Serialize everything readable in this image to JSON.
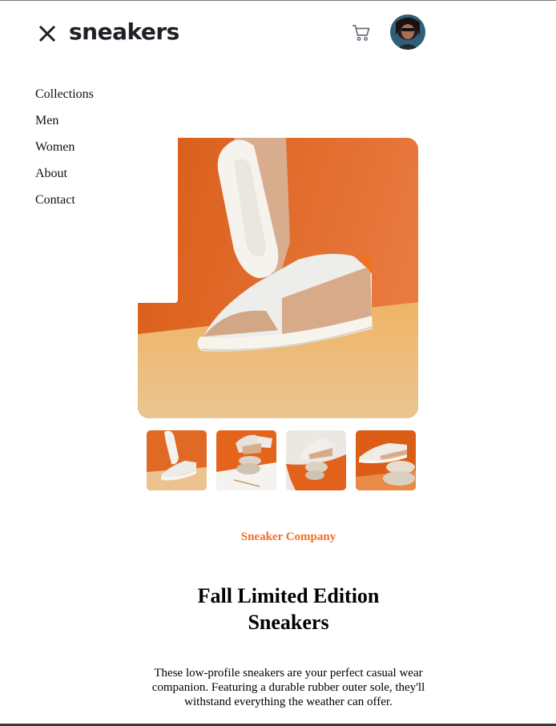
{
  "header": {
    "close_icon": "close-icon",
    "brand": "sneakers",
    "cart_icon": "cart-icon",
    "avatar_icon": "user-avatar"
  },
  "nav": {
    "items": [
      {
        "label": "Collections"
      },
      {
        "label": "Men"
      },
      {
        "label": "Women"
      },
      {
        "label": "About"
      },
      {
        "label": "Contact"
      }
    ]
  },
  "product": {
    "company": "Sneaker Company",
    "title_line1": "Fall Limited Edition",
    "title_line2": "Sneakers",
    "description": "These low-profile sneakers are your perfect casual wear companion. Featuring a durable rubber outer sole, they'll withstand everything the weather can offer.",
    "thumbnail_count": 4
  },
  "colors": {
    "accent": "#f26f26",
    "brand_text": "#1d2026",
    "photo_orange": "#e26a22",
    "photo_floor": "#e8b77c"
  }
}
